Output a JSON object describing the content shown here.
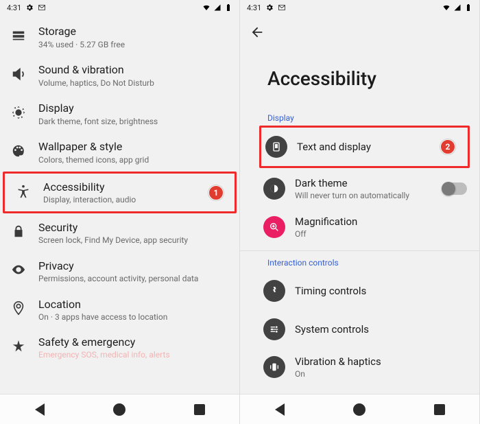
{
  "status": {
    "time": "4:31"
  },
  "left": {
    "items": [
      {
        "title": "Storage",
        "sub": "34% used · 5.27 GB free"
      },
      {
        "title": "Sound & vibration",
        "sub": "Volume, haptics, Do Not Disturb"
      },
      {
        "title": "Display",
        "sub": "Dark theme, font size, brightness"
      },
      {
        "title": "Wallpaper & style",
        "sub": "Colors, themed icons, app grid"
      },
      {
        "title": "Accessibility",
        "sub": "Display, interaction, audio"
      },
      {
        "title": "Security",
        "sub": "Screen lock, Find My Device, app security"
      },
      {
        "title": "Privacy",
        "sub": "Permissions, account activity, personal data"
      },
      {
        "title": "Location",
        "sub": "On · 3 apps have access to location"
      },
      {
        "title": "Safety & emergency",
        "sub": "Emergency SOS, medical info, alerts"
      }
    ],
    "badge1": "1"
  },
  "right": {
    "pageTitle": "Accessibility",
    "sectionDisplay": "Display",
    "sectionInteraction": "Interaction controls",
    "items": {
      "textDisplay": {
        "title": "Text and display"
      },
      "darkTheme": {
        "title": "Dark theme",
        "sub": "Will never turn on automatically"
      },
      "magnification": {
        "title": "Magnification",
        "sub": "Off"
      },
      "timing": {
        "title": "Timing controls"
      },
      "system": {
        "title": "System controls"
      },
      "vibration": {
        "title": "Vibration & haptics",
        "sub": "On"
      }
    },
    "badge2": "2"
  }
}
